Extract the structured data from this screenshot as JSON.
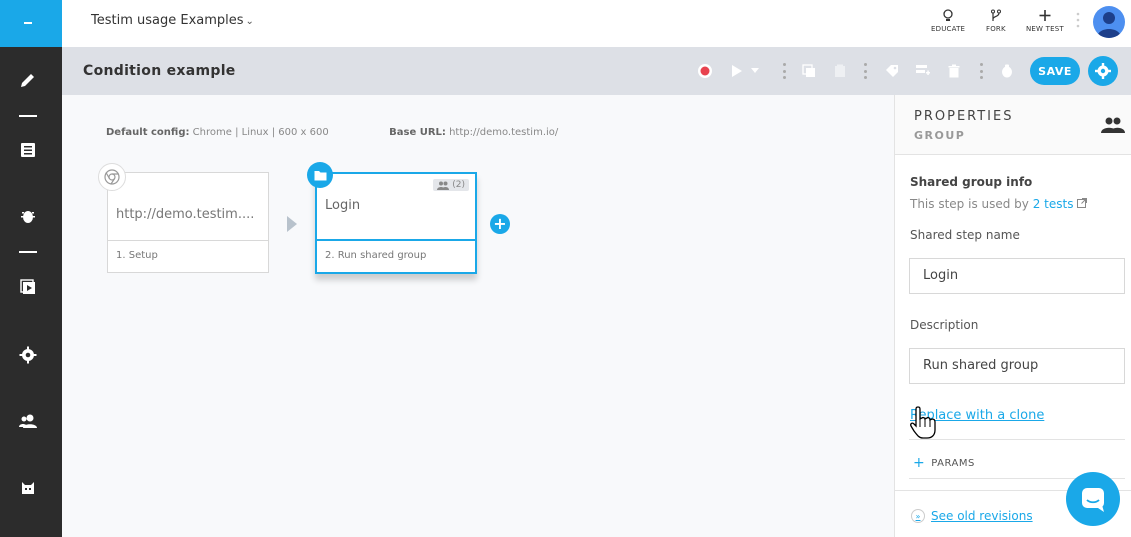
{
  "app": {
    "project_title": "Testim usage Examples",
    "nav_icons": [
      "pencil-icon",
      "list-icon",
      "bug-icon",
      "play-folder-icon",
      "gear-icon",
      "users-icon",
      "mascot-icon"
    ]
  },
  "header": {
    "actions": [
      {
        "icon": "lightbulb-icon",
        "label": "EDUCATE"
      },
      {
        "icon": "fork-icon",
        "label": "FORK"
      },
      {
        "icon": "plus-icon",
        "label": "NEW TEST"
      }
    ]
  },
  "testbar": {
    "title": "Condition example",
    "save_label": "SAVE"
  },
  "canvas": {
    "config_label": "Default config:",
    "config_value": "Chrome | Linux | 600 x 600",
    "base_url_label": "Base URL:",
    "base_url_value": "http://demo.testim.io/",
    "steps": [
      {
        "title": "http://demo.testim....",
        "caption": "1. Setup"
      },
      {
        "title": "Login",
        "caption": "2. Run shared group",
        "shared_count": "(2)"
      }
    ]
  },
  "panel": {
    "title": "PROPERTIES",
    "subtitle": "GROUP",
    "shared_info_title": "Shared group info",
    "shared_info_prefix": "This step is used by",
    "shared_info_link": "2 tests",
    "shared_name_label": "Shared step name",
    "shared_name_value": "Login",
    "description_label": "Description",
    "description_value": "Run shared group",
    "replace_link": "Replace with a clone",
    "params_label": "PARAMS",
    "revisions_link": "See old revisions"
  },
  "colors": {
    "accent": "#1aa8e8",
    "nav_bg": "#2c2c2c",
    "toolbar_bg": "#dde0e6",
    "record": "#e8424f"
  }
}
